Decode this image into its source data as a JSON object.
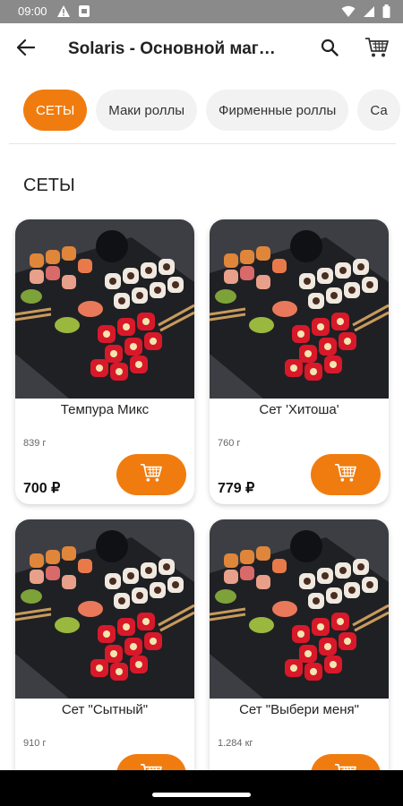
{
  "status_bar": {
    "time": "09:00",
    "icons": [
      "warning-icon",
      "sim-icon",
      "wifi-icon",
      "signal-icon",
      "battery-icon"
    ]
  },
  "app_bar": {
    "title": "Solaris - Основной магазин",
    "back_icon": "arrow-left-icon",
    "search_icon": "search-icon",
    "cart_icon": "cart-icon"
  },
  "categories": [
    {
      "label": "СЕТЫ",
      "active": true
    },
    {
      "label": "Маки роллы",
      "active": false
    },
    {
      "label": "Фирменные роллы",
      "active": false
    },
    {
      "label": "Са",
      "active": false
    }
  ],
  "section": {
    "title": "СЕТЫ"
  },
  "products": [
    {
      "name": "Темпура Микс",
      "weight": "839 г",
      "price": "700 ₽"
    },
    {
      "name": "Сет 'Хитоша'",
      "weight": "760 г",
      "price": "779 ₽"
    },
    {
      "name": "Сет \"Сытный\"",
      "weight": "910 г",
      "price": ""
    },
    {
      "name": "Сет \"Выбери меня\"",
      "weight": "1.284 кг",
      "price": ""
    }
  ],
  "colors": {
    "accent": "#f07c0f",
    "chip_bg": "#f2f2f2",
    "status_bar": "#8a8a8a"
  }
}
